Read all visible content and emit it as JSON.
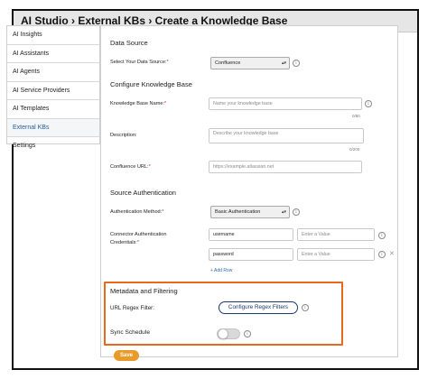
{
  "title": "AI Studio › External KBs › Create a Knowledge Base",
  "sidebar": {
    "items": [
      {
        "label": "AI Insights"
      },
      {
        "label": "AI Assistants"
      },
      {
        "label": "AI Agents"
      },
      {
        "label": "AI Service Providers"
      },
      {
        "label": "AI Templates"
      },
      {
        "label": "External KBs",
        "active": true
      },
      {
        "label": "Settings"
      }
    ]
  },
  "form": {
    "data_source": {
      "heading": "Data Source",
      "label": "Select Your Data Source:",
      "required_mark": "*",
      "value": "Confluence"
    },
    "configure": {
      "heading": "Configure Knowledge Base",
      "name_label": "Knowledge Base Name:",
      "name_placeholder": "Name your knowledge base",
      "name_counter": "0/80",
      "description_label": "Description:",
      "description_placeholder": "Describe your knowledge base",
      "description_counter": "0/200",
      "url_label": "Confluence URL:",
      "url_placeholder": "https://example.atlassian.net"
    },
    "auth": {
      "heading": "Source Authentication",
      "method_label": "Authentication Method:",
      "method_value": "Basic Authentication",
      "credentials_label_1": "Connector Authentication",
      "credentials_label_2": "Credentials:",
      "rows": [
        {
          "key": "username",
          "value_placeholder": "Enter a Value"
        },
        {
          "key": "password",
          "value_placeholder": "Enter a Value"
        }
      ],
      "add_row": "+ Add Row"
    },
    "metadata": {
      "heading": "Metadata and Filtering",
      "regex_label": "URL Regex Filter:",
      "regex_button": "Configure Regex Filters",
      "sync_label": "Sync Schedule",
      "sync_enabled": false
    },
    "save": "Save"
  },
  "icons": {
    "info": "info-icon",
    "remove_row": "close-icon",
    "dropdown": "chevron-updown-icon"
  },
  "colors": {
    "highlight": "#e8681e",
    "save_button": "#e89a2a",
    "link": "#2a6db5",
    "regex_button": "#1f3a6d",
    "required": "#c0392b"
  }
}
